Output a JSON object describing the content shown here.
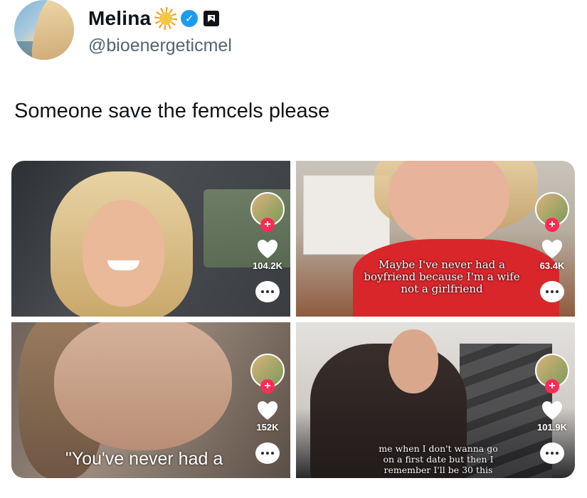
{
  "author": {
    "display_name": "Melina",
    "handle": "@bioenergeticmel",
    "emoji_icon": "sun-emoji-icon",
    "verified_icon": "verified-check-icon",
    "affiliate_icon": "label-badge-icon"
  },
  "tweet": {
    "text": "Someone save the femcels please"
  },
  "media": [
    {
      "like_count": "104.2K",
      "caption": ""
    },
    {
      "like_count": "63.4K",
      "caption": "Maybe I've never had a boyfriend because I'm a wife not a girlfriend"
    },
    {
      "like_count": "152K",
      "caption": "\"You've never had a"
    },
    {
      "like_count": "101.9K",
      "caption": "me when I don't wanna go on a first date but then I remember I'll be 30 this"
    }
  ],
  "colors": {
    "text_primary": "#0f1419",
    "text_secondary": "#536471",
    "verified_blue": "#1d9bf0",
    "tiktok_follow_red": "#fe2c55"
  }
}
